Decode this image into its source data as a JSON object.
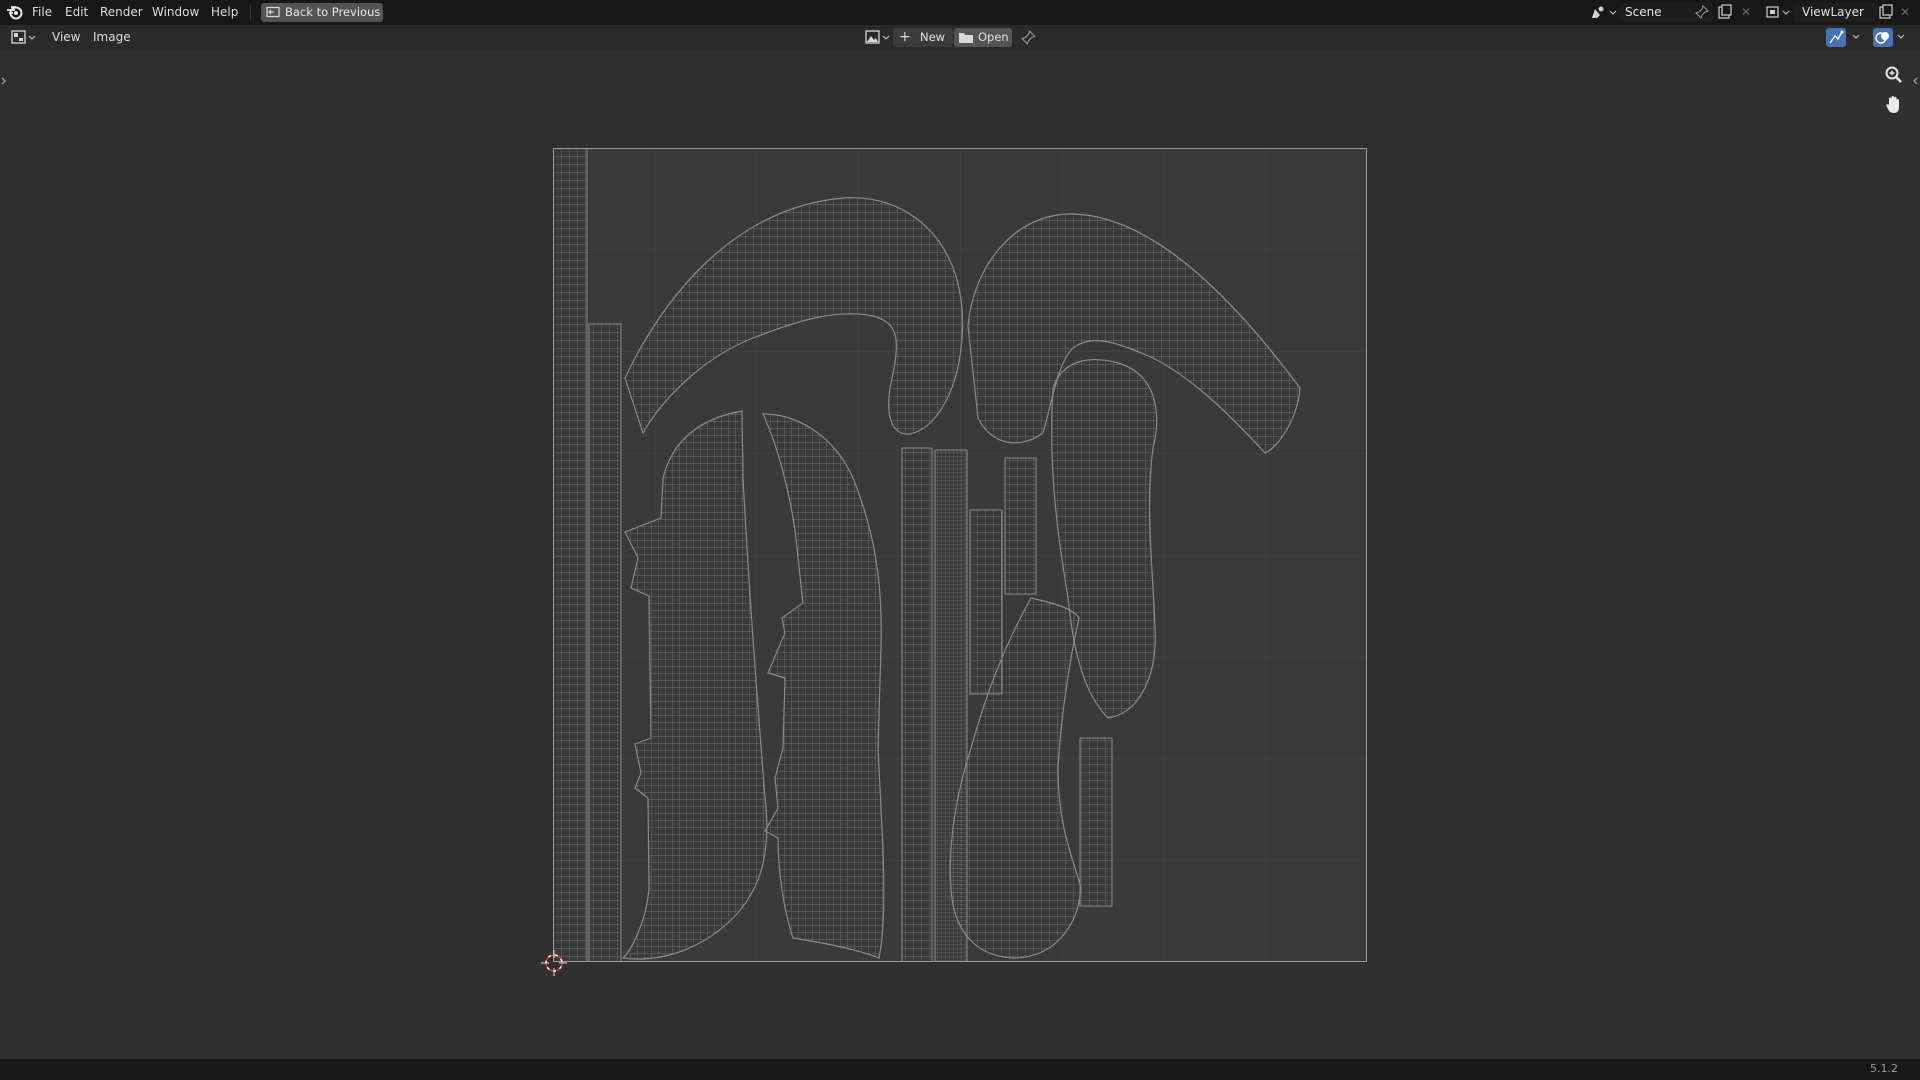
{
  "menu": {
    "items": [
      "File",
      "Edit",
      "Render",
      "Window",
      "Help"
    ],
    "back_label": "Back to Previous"
  },
  "scene": {
    "name": "Scene"
  },
  "view_layer": {
    "name": "ViewLayer"
  },
  "editor_header": {
    "menus": [
      "View",
      "Image"
    ],
    "new_label": "New",
    "open_label": "Open"
  },
  "status_bar": {
    "version": "5.1.2"
  },
  "icons": {
    "blender_logo": "blender-logo-icon",
    "editor_type": "image-editor-icon",
    "zoom": "zoom-icon",
    "pan": "hand-pan-icon",
    "cursor": "2d-cursor-icon"
  },
  "colors": {
    "topbar": "#181818",
    "header": "#2a2a2a",
    "viewport": "#303030",
    "uv_canvas": "#3a3a3a",
    "wire": "#8a8a8a",
    "accent": "#4772b3"
  }
}
